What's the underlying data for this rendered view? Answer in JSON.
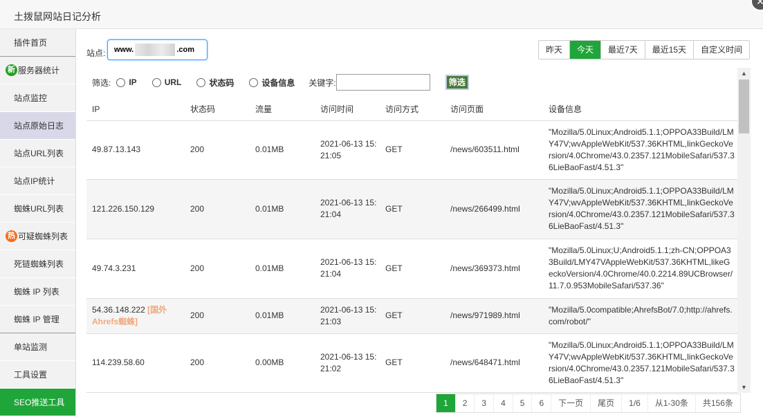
{
  "window": {
    "title": "土拨鼠网站日记分析"
  },
  "sidebar": {
    "items": [
      {
        "label": "插件首页"
      },
      {
        "label": "服务器统计",
        "badge": "新"
      },
      {
        "label": "站点监控"
      },
      {
        "label": "站点原始日志"
      },
      {
        "label": "站点URL列表"
      },
      {
        "label": "站点IP统计"
      },
      {
        "label": "蜘蛛URL列表"
      },
      {
        "label": "可疑蜘蛛列表",
        "badge": "热"
      },
      {
        "label": "死链蜘蛛列表"
      },
      {
        "label": "蜘蛛 IP 列表"
      },
      {
        "label": "蜘蛛 IP 管理"
      },
      {
        "label": "单站监测"
      },
      {
        "label": "工具设置"
      },
      {
        "label": "SEO推送工具"
      }
    ]
  },
  "site": {
    "label": "站点:",
    "value_prefix": "www.",
    "value_suffix": ".com"
  },
  "date_range": {
    "buttons": [
      "昨天",
      "今天",
      "最近7天",
      "最近15天",
      "自定义时间"
    ],
    "active": "今天"
  },
  "filter": {
    "label": "筛选:",
    "options": [
      "IP",
      "URL",
      "状态码",
      "设备信息"
    ],
    "keyword_label": "关键字:",
    "keyword_value": "",
    "button": "筛选"
  },
  "table": {
    "headers": [
      "IP",
      "状态码",
      "流量",
      "访问时间",
      "访问方式",
      "访问页面",
      "设备信息"
    ],
    "rows": [
      {
        "ip": "49.87.13.143",
        "tag": "",
        "status": "200",
        "traffic": "0.01MB",
        "time": "2021-06-13 15:21:05",
        "method": "GET",
        "page": "/news/603511.html",
        "ua": "\"Mozilla/5.0Linux;Android5.1.1;OPPOA33Build/LMY47V;wvAppleWebKit/537.36KHTML,linkGeckoVersion/4.0Chrome/43.0.2357.121MobileSafari/537.36LieBaoFast/4.51.3\""
      },
      {
        "ip": "121.226.150.129",
        "tag": "",
        "status": "200",
        "traffic": "0.01MB",
        "time": "2021-06-13 15:21:04",
        "method": "GET",
        "page": "/news/266499.html",
        "ua": "\"Mozilla/5.0Linux;Android5.1.1;OPPOA33Build/LMY47V;wvAppleWebKit/537.36KHTML,linkGeckoVersion/4.0Chrome/43.0.2357.121MobileSafari/537.36LieBaoFast/4.51.3\""
      },
      {
        "ip": "49.74.3.231",
        "tag": "",
        "status": "200",
        "traffic": "0.01MB",
        "time": "2021-06-13 15:21:04",
        "method": "GET",
        "page": "/news/369373.html",
        "ua": "\"Mozilla/5.0Linux;U;Android5.1.1;zh-CN;OPPOA33Build/LMY47VAppleWebKit/537.36KHTML,likeGeckoVersion/4.0Chrome/40.0.2214.89UCBrowser/11.7.0.953MobileSafari/537.36\""
      },
      {
        "ip": "54.36.148.222",
        "tag": "[国外Ahrefs蜘蛛]",
        "status": "200",
        "traffic": "0.01MB",
        "time": "2021-06-13 15:21:03",
        "method": "GET",
        "page": "/news/971989.html",
        "ua": "\"Mozilla/5.0compatible;AhrefsBot/7.0;http://ahrefs.com/robot/\""
      },
      {
        "ip": "114.239.58.60",
        "tag": "",
        "status": "200",
        "traffic": "0.00MB",
        "time": "2021-06-13 15:21:02",
        "method": "GET",
        "page": "/news/648471.html",
        "ua": "\"Mozilla/5.0Linux;Android5.1.1;OPPOA33Build/LMY47V;wvAppleWebKit/537.36KHTML,linkGeckoVersion/4.0Chrome/43.0.2357.121MobileSafari/537.36LieBaoFast/4.51.3\""
      }
    ]
  },
  "pager": {
    "pages": [
      "1",
      "2",
      "3",
      "4",
      "5",
      "6"
    ],
    "current": "1",
    "next": "下一页",
    "last": "尾页",
    "page_info": "1/6",
    "range": "从1-30条",
    "total": "共156条"
  },
  "icons": {
    "close": "close-icon",
    "scroll_up": "scroll-up-arrow-icon",
    "scroll_down": "scroll-down-arrow-icon"
  },
  "colors": {
    "accent": "#20a53a",
    "sidebar_active": "#d8d8e8",
    "foreign_tag": "#f0a87c",
    "new_badge": "#22a022",
    "hot_badge": "#f36b18"
  }
}
